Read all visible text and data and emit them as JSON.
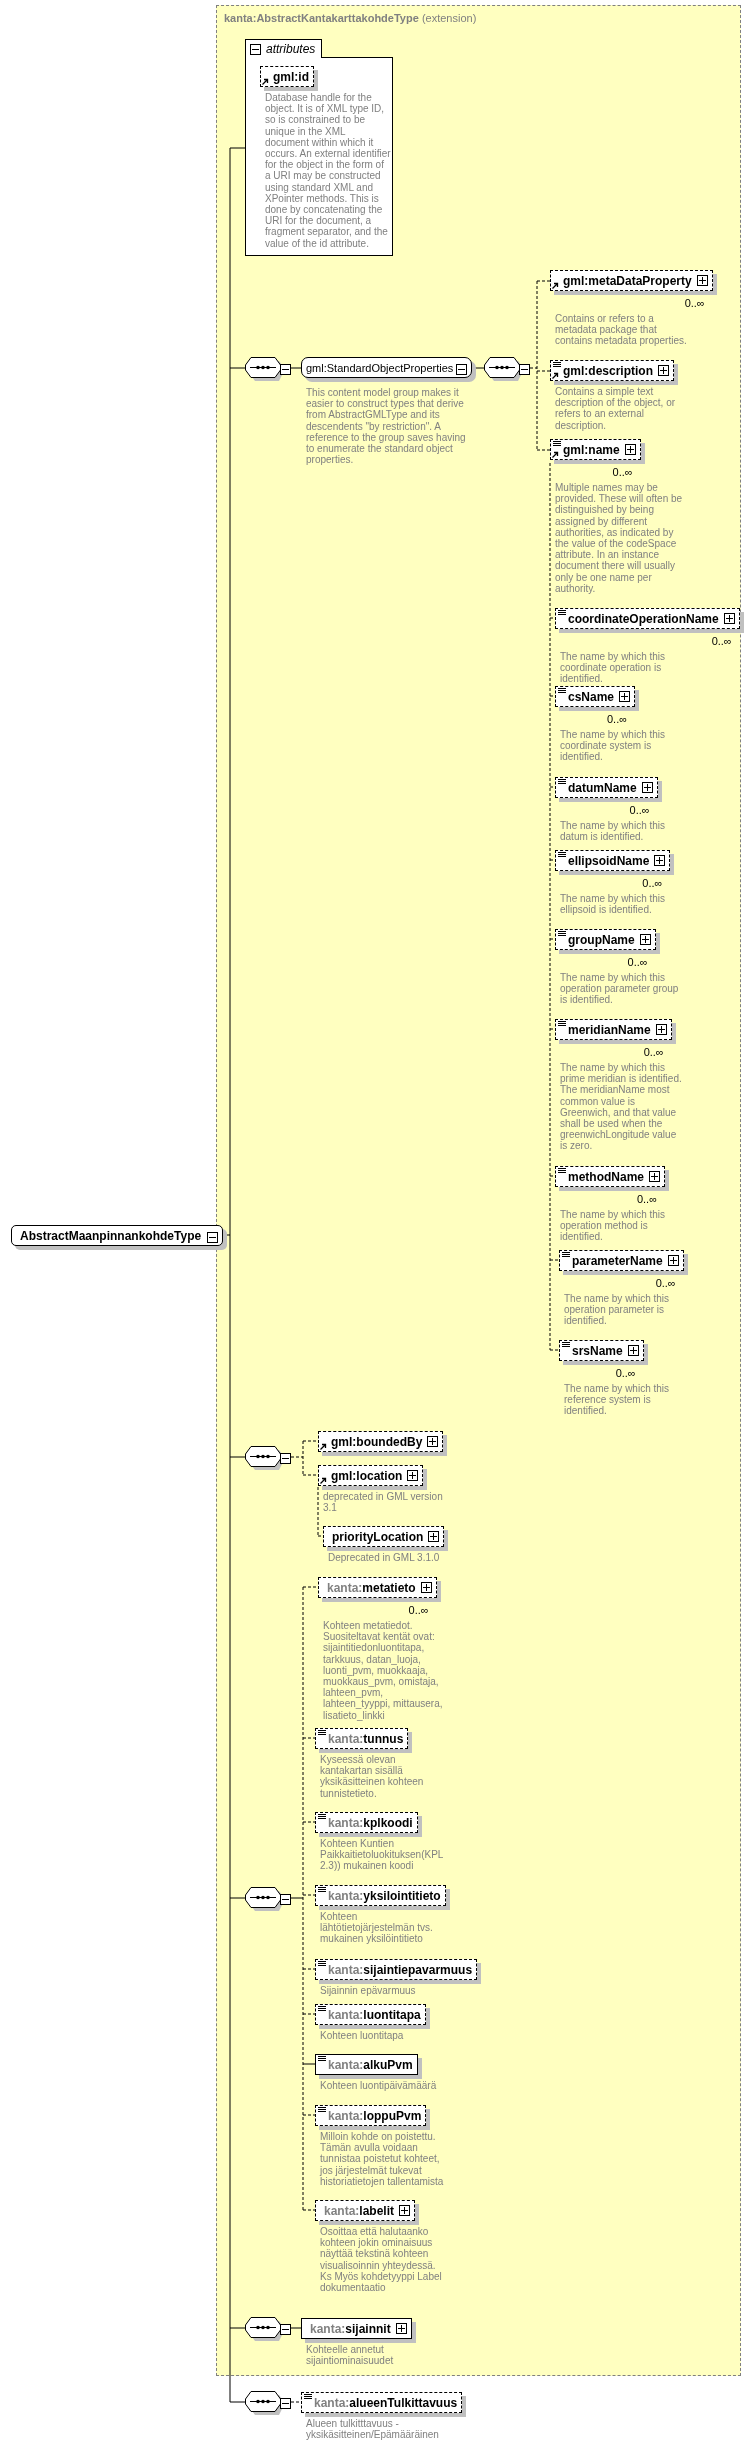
{
  "root": {
    "name": "AbstractMaanpinnankohdeType",
    "expanded": true
  },
  "extension": {
    "base_prefix": "kanta:",
    "base_name": "AbstractKantakarttakohdeType",
    "derivation": "(extension)"
  },
  "attributes": {
    "title": "attributes",
    "expanded": true,
    "items": [
      {
        "name": "gml:id",
        "optional": true,
        "reference": true,
        "documentation": "Database handle for the object. It is of XML type ID, so is constrained to be unique in the XML document within which it occurs. An external identifier for the object in the form of a URI may be constructed using standard XML and XPointer methods. This is done by concatenating the URI for the document, a fragment separator, and the value of the id attribute."
      }
    ]
  },
  "sequences": [
    {
      "expanded": true,
      "items": [
        {
          "kind": "group",
          "name": "gml:StandardObjectProperties",
          "expanded": true,
          "documentation": "This content model group makes it easier to construct types that derive from AbstractGMLType and its descendents \"by restriction\". A reference to the group saves having to enumerate the standard object properties.",
          "sequence": {
            "expanded": true,
            "items": [
              {
                "kind": "element",
                "name": "gml:metaDataProperty",
                "optional": true,
                "reference": true,
                "simple_content": false,
                "expandable": true,
                "occurs": "0..∞",
                "documentation": "Contains or refers to a metadata package that contains metadata properties."
              },
              {
                "kind": "element",
                "name": "gml:description",
                "optional": true,
                "reference": true,
                "simple_content": true,
                "expandable": true,
                "documentation": "Contains a simple text description of the object, or refers to an external description."
              },
              {
                "kind": "element",
                "name": "gml:name",
                "optional": true,
                "reference": true,
                "simple_content": true,
                "expandable": true,
                "occurs": "0..∞",
                "documentation": "Multiple names may be provided. These will often be distinguished by being assigned by different authorities, as indicated by the value of the codeSpace attribute. In an instance document there will usually only be one name per authority.",
                "substitutes": [
                  {
                    "name": "coordinateOperationName",
                    "optional": true,
                    "reference": false,
                    "simple_content": true,
                    "expandable": true,
                    "occurs": "0..∞",
                    "documentation": "The name by which this coordinate operation is identified."
                  },
                  {
                    "name": "csName",
                    "optional": true,
                    "reference": false,
                    "simple_content": true,
                    "expandable": true,
                    "occurs": "0..∞",
                    "documentation": "The name by which this coordinate system is identified."
                  },
                  {
                    "name": "datumName",
                    "optional": true,
                    "reference": false,
                    "simple_content": true,
                    "expandable": true,
                    "occurs": "0..∞",
                    "documentation": "The name by which this datum is identified."
                  },
                  {
                    "name": "ellipsoidName",
                    "optional": true,
                    "reference": false,
                    "simple_content": true,
                    "expandable": true,
                    "occurs": "0..∞",
                    "documentation": "The name by which this ellipsoid is identified."
                  },
                  {
                    "name": "groupName",
                    "optional": true,
                    "reference": false,
                    "simple_content": true,
                    "expandable": true,
                    "occurs": "0..∞",
                    "documentation": "The name by which this operation parameter group is identified."
                  },
                  {
                    "name": "meridianName",
                    "optional": true,
                    "reference": false,
                    "simple_content": true,
                    "expandable": true,
                    "occurs": "0..∞",
                    "documentation": "The name by which this prime meridian is identified. The meridianName most common value is Greenwich, and that value shall be used when the greenwichLongitude value is zero."
                  },
                  {
                    "name": "methodName",
                    "optional": true,
                    "reference": false,
                    "simple_content": true,
                    "expandable": true,
                    "occurs": "0..∞",
                    "documentation": "The name by which this operation method is identified."
                  },
                  {
                    "name": "parameterName",
                    "optional": true,
                    "reference": false,
                    "simple_content": true,
                    "expandable": true,
                    "occurs": "0..∞",
                    "documentation": "The name by which this operation parameter is identified."
                  },
                  {
                    "name": "srsName",
                    "optional": true,
                    "reference": false,
                    "simple_content": true,
                    "expandable": true,
                    "occurs": "0..∞",
                    "documentation": "The name by which this reference system is identified."
                  }
                ]
              }
            ]
          }
        }
      ]
    },
    {
      "expanded": true,
      "items": [
        {
          "kind": "element",
          "name": "gml:boundedBy",
          "optional": true,
          "reference": true,
          "simple_content": false,
          "expandable": true
        },
        {
          "kind": "element",
          "name": "gml:location",
          "optional": true,
          "reference": true,
          "simple_content": false,
          "expandable": true,
          "documentation": "deprecated in GML version 3.1",
          "substitutes": [
            {
              "name": "priorityLocation",
              "optional": true,
              "reference": false,
              "simple_content": false,
              "expandable": true,
              "documentation": "Deprecated in GML 3.1.0"
            }
          ]
        }
      ]
    },
    {
      "expanded": true,
      "items": [
        {
          "kind": "element",
          "prefix": "kanta:",
          "name": "metatieto",
          "optional": true,
          "reference": false,
          "simple_content": false,
          "expandable": true,
          "occurs": "0..∞",
          "documentation": "Kohteen metatiedot. Suositeltavat kentät ovat: sijaintitiedonluontitapa, tarkkuus, datan_luoja, luonti_pvm, muokkaaja, muokkaus_pvm, omistaja, lahteen_pvm, lahteen_tyyppi, mittausera, lisatieto_linkki"
        },
        {
          "kind": "element",
          "prefix": "kanta:",
          "name": "tunnus",
          "optional": true,
          "reference": false,
          "simple_content": true,
          "expandable": false,
          "documentation": "Kyseessä olevan kantakartan sisällä yksikäsitteinen kohteen tunnistetieto."
        },
        {
          "kind": "element",
          "prefix": "kanta:",
          "name": "kplkoodi",
          "optional": true,
          "reference": false,
          "simple_content": true,
          "expandable": false,
          "documentation": "Kohteen Kuntien Paikkaitietoluokituksen(KPL 2.3)) mukainen koodi"
        },
        {
          "kind": "element",
          "prefix": "kanta:",
          "name": "yksilointitieto",
          "optional": true,
          "reference": false,
          "simple_content": true,
          "expandable": false,
          "documentation": "Kohteen lähtötietojärjestelmän tvs. mukainen yksilöintitieto"
        },
        {
          "kind": "element",
          "prefix": "kanta:",
          "name": "sijaintiepavarmuus",
          "optional": true,
          "reference": false,
          "simple_content": true,
          "expandable": false,
          "documentation": "Sijainnin epävarmuus"
        },
        {
          "kind": "element",
          "prefix": "kanta:",
          "name": "luontitapa",
          "optional": true,
          "reference": false,
          "simple_content": true,
          "expandable": false,
          "documentation": "Kohteen luontitapa"
        },
        {
          "kind": "element",
          "prefix": "kanta:",
          "name": "alkuPvm",
          "optional": false,
          "reference": false,
          "simple_content": true,
          "expandable": false,
          "documentation": "Kohteen luontipäivämäärä"
        },
        {
          "kind": "element",
          "prefix": "kanta:",
          "name": "loppuPvm",
          "optional": true,
          "reference": false,
          "simple_content": true,
          "expandable": false,
          "documentation": "Milloin kohde on poistettu. Tämän avulla voidaan tunnistaa poistetut kohteet, jos järjestelmät tukevat historiatietojen tallentamista"
        },
        {
          "kind": "element",
          "prefix": "kanta:",
          "name": "labelit",
          "optional": true,
          "reference": false,
          "simple_content": false,
          "expandable": true,
          "documentation": "Osoittaa että halutaanko kohteen jokin ominaisuus näyttää tekstinä kohteen visualisoinnin yhteydessä. Ks Myös kohdetyyppi Label dokumentaatio"
        }
      ]
    },
    {
      "expanded": true,
      "items": [
        {
          "kind": "element",
          "prefix": "kanta:",
          "name": "sijainnit",
          "optional": false,
          "reference": false,
          "simple_content": false,
          "expandable": true,
          "documentation": "Kohteelle annetut sijaintiominaisuudet"
        }
      ]
    },
    {
      "expanded": true,
      "items": [
        {
          "kind": "element",
          "prefix": "kanta:",
          "name": "alueenTulkittavuus",
          "optional": true,
          "reference": false,
          "simple_content": true,
          "expandable": false,
          "documentation": "Alueen tulkitttavuus - yksikäsitteinen/Epämääräinen"
        }
      ]
    }
  ]
}
